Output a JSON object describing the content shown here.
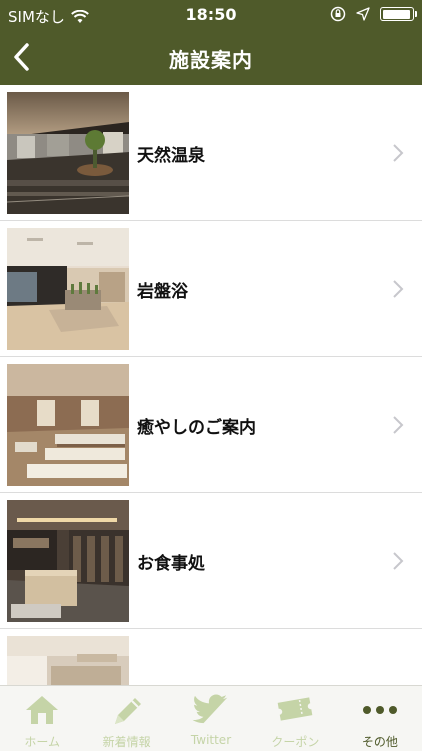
{
  "status": {
    "carrier": "SIMなし",
    "time": "18:50",
    "battery_level": 0.9
  },
  "nav": {
    "title": "施設案内"
  },
  "rows": [
    {
      "label": "天然温泉"
    },
    {
      "label": "岩盤浴"
    },
    {
      "label": "癒やしのご案内"
    },
    {
      "label": "お食事処"
    },
    {
      "label": ""
    }
  ],
  "tabs": [
    {
      "label": "ホーム",
      "icon": "home-icon"
    },
    {
      "label": "新着情報",
      "icon": "pencil-icon"
    },
    {
      "label": "Twitter",
      "icon": "twitter-bird-icon"
    },
    {
      "label": "クーポン",
      "icon": "ticket-icon"
    },
    {
      "label": "その他",
      "icon": "more-dots-icon"
    }
  ],
  "colors": {
    "bar": "#4f5a2a",
    "tab_inactive": "#c5d4a7",
    "tab_active": "#4f5a2a"
  }
}
